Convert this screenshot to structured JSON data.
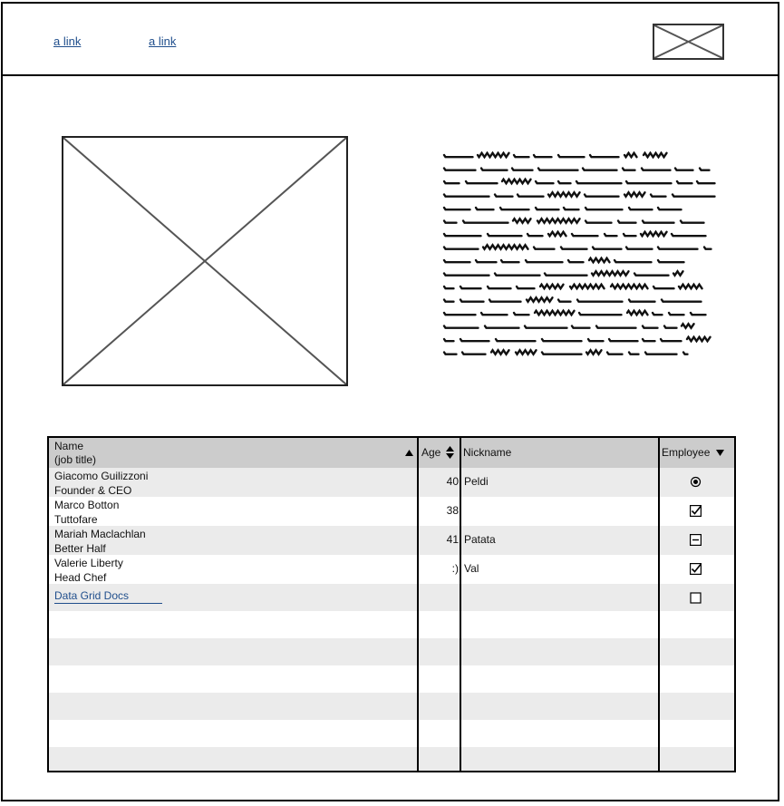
{
  "header": {
    "links": [
      "a link",
      "a link"
    ],
    "logo_icon": "image-placeholder-icon"
  },
  "hero": {
    "image_icon": "image-placeholder-icon",
    "text_icon": "scribbled-text-block"
  },
  "grid": {
    "columns": {
      "name": "Name",
      "name_sub": "(job title)",
      "age": "Age",
      "nickname": "Nickname",
      "employee": "Employee"
    },
    "rows": [
      {
        "name": "Giacomo Guilizzoni",
        "title": "Founder & CEO",
        "age": "40",
        "nickname": "Peldi",
        "employee": "radio-selected"
      },
      {
        "name": "Marco Botton",
        "title": "Tuttofare",
        "age": "38",
        "nickname": "",
        "employee": "checked"
      },
      {
        "name": "Mariah Maclachlan",
        "title": "Better Half",
        "age": "41",
        "nickname": "Patata",
        "employee": "indeterminate"
      },
      {
        "name": "Valerie Liberty",
        "title": "Head Chef",
        "age": ":)",
        "nickname": "Val",
        "employee": "checked"
      }
    ],
    "docs_link": "Data Grid Docs",
    "docs_employee": "unchecked"
  }
}
